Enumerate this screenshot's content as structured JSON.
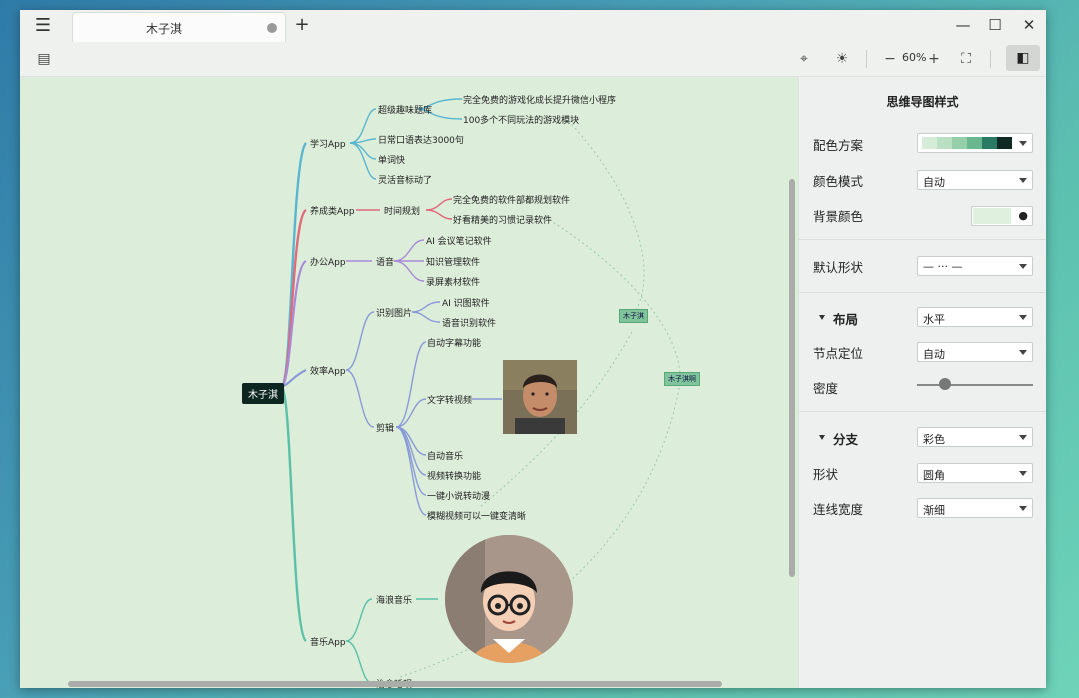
{
  "titlebar": {
    "menu_icon": "menu-icon",
    "tab_title": "木子淇",
    "add_label": "+"
  },
  "window_controls": {
    "minimize": "—",
    "maximize": "☐",
    "close": "✕"
  },
  "toolbar": {
    "zoom": "60%",
    "zoom_out": "−",
    "zoom_in": "+"
  },
  "panel": {
    "title": "思维导图样式",
    "scheme_label": "配色方案",
    "scheme_colors": [
      "#d5ecd8",
      "#b9e0c3",
      "#94cfa9",
      "#6ab68f",
      "#2b7a63",
      "#0f2a23"
    ],
    "color_mode_label": "颜色模式",
    "color_mode_value": "自动",
    "bg_label": "背景颜色",
    "bg_color": "#e0f0df",
    "shape_label": "默认形状",
    "shape_value": "— ··· —",
    "layout_label": "布局",
    "layout_value": "水平",
    "node_pos_label": "节点定位",
    "node_pos_value": "自动",
    "density_label": "密度",
    "branch_label": "分支",
    "branch_value": "彩色",
    "form_label": "形状",
    "form_value": "圆角",
    "line_width_label": "连线宽度",
    "line_width_value": "渐细"
  },
  "mindmap": {
    "root": "木子淇",
    "tag1": "木子淇",
    "tag2": "木子淇啊",
    "branches": {
      "study": "学习App",
      "study_1": "超级趣味题库",
      "study_1a": "完全免费的游戏化成长提升微信小程序",
      "study_1b": "100多个不同玩法的游戏模块",
      "study_2": "日常口语表达3000句",
      "study_3": "单词快",
      "study_4": "灵活音标动了",
      "habit": "养成类App",
      "habit_1": "时间规划",
      "habit_1a": "完全免费的软件部都规划软件",
      "habit_1b": "好看精美的习惯记录软件",
      "office": "办公App",
      "office_1": "语音",
      "office_1a": "AI 会议笔记软件",
      "office_1b": "知识管理软件",
      "office_1c": "录屏素材软件",
      "effect": "效率App",
      "effect_1": "识别图片",
      "effect_1a": "AI 识图软件",
      "effect_1b": "语音识别软件",
      "effect_2": "剪辑",
      "effect_2a": "自动字幕功能",
      "effect_2b": "文字转视频",
      "effect_2c": "自动音乐",
      "effect_2d": "视频转换功能",
      "effect_2e": "一键小说转动漫",
      "effect_2f": "模糊视频可以一键变清晰",
      "music": "音乐App",
      "music_1": "海浪音乐",
      "music_2": "治愈睡眠"
    }
  }
}
